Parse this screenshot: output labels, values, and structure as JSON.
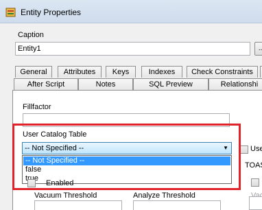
{
  "window": {
    "title": "Entity Properties"
  },
  "caption": {
    "label": "Caption",
    "value": "Entity1",
    "button_label": "..."
  },
  "tabs_row1": [
    "General",
    "Attributes",
    "Keys",
    "Indexes",
    "Check Constraints",
    "Ta"
  ],
  "tabs_row2": [
    "After Script",
    "Notes",
    "SQL Preview",
    "Relationshi"
  ],
  "fields": {
    "fillfactor_label": "Fillfactor",
    "user_catalog_label": "User Catalog Table",
    "user_catalog_selected": "-- Not Specified --",
    "options": [
      "-- Not Specified --",
      "false",
      "true"
    ],
    "enabled_label": "Enabled",
    "vacuum_label": "Vacuum Threshold",
    "analyze_label": "Analyze Threshold"
  },
  "right_side": {
    "use_label": "Use",
    "toast_label": "TOAS",
    "vac_label": "Vac"
  },
  "colors": {
    "highlight": "#e0232b",
    "selection": "#3399ff"
  }
}
